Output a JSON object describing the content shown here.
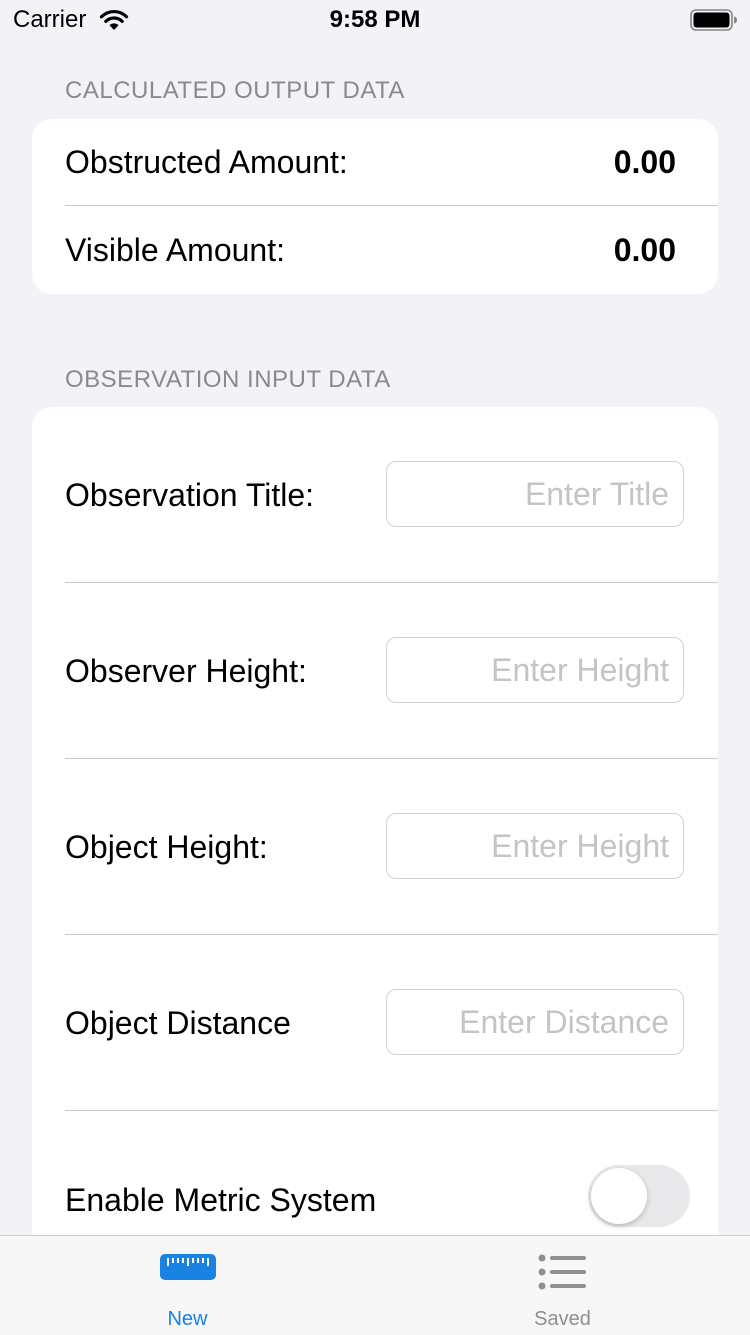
{
  "status_bar": {
    "carrier": "Carrier",
    "time": "9:58 PM",
    "wifi_icon": "wifi-icon",
    "battery_icon": "battery-full-icon"
  },
  "output_section": {
    "header": "CALCULATED OUTPUT DATA",
    "rows": [
      {
        "label": "Obstructed Amount:",
        "value": "0.00"
      },
      {
        "label": "Visible Amount:",
        "value": "0.00"
      }
    ]
  },
  "input_section": {
    "header": "OBSERVATION INPUT DATA",
    "fields": [
      {
        "label": "Observation Title:",
        "value": "",
        "placeholder": "Enter Title"
      },
      {
        "label": "Observer Height:",
        "value": "",
        "placeholder": "Enter Height"
      },
      {
        "label": "Object Height:",
        "value": "",
        "placeholder": "Enter Height"
      },
      {
        "label": "Object Distance",
        "value": "",
        "placeholder": "Enter Distance"
      }
    ],
    "metric_toggle": {
      "label": "Enable Metric System",
      "on": false
    }
  },
  "tab_bar": {
    "active_color": "#1a82e2",
    "inactive_color": "#8e8e93",
    "tabs": [
      {
        "label": "New",
        "icon": "ruler-icon",
        "active": true
      },
      {
        "label": "Saved",
        "icon": "list-icon",
        "active": false
      }
    ]
  }
}
